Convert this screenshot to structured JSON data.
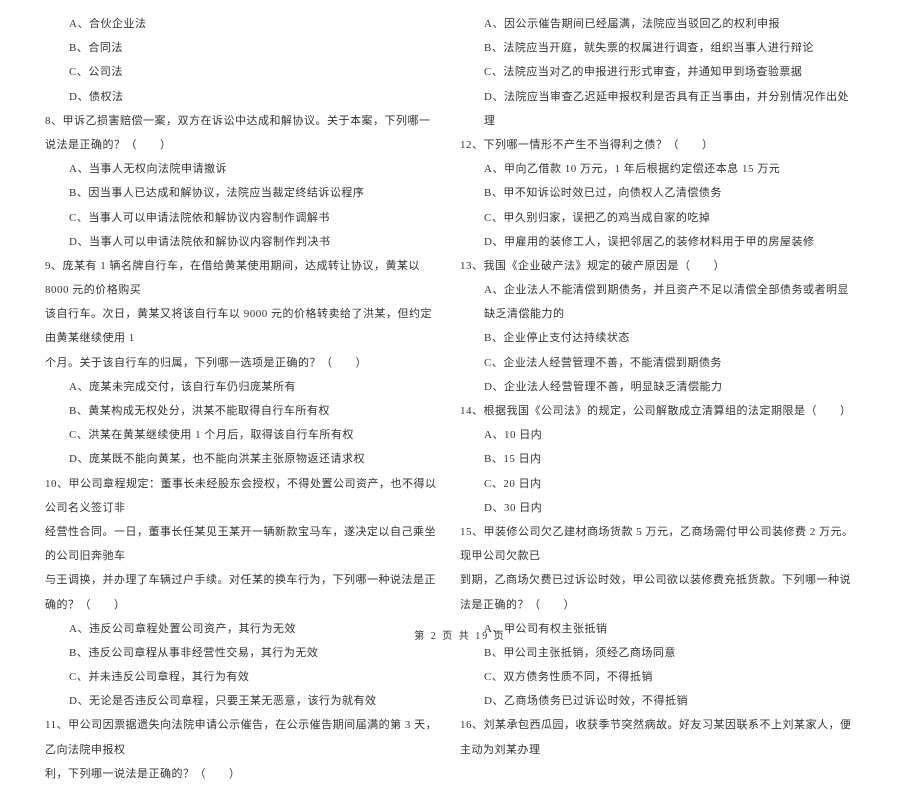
{
  "left": {
    "a1": "A、合伙企业法",
    "a2": "B、合同法",
    "a3": "C、公司法",
    "a4": "D、债权法",
    "q8": "8、甲诉乙损害赔偿一案，双方在诉讼中达成和解协议。关于本案，下列哪一说法是正确的？（　　）",
    "q8a": "A、当事人无权向法院申请撤诉",
    "q8b": "B、因当事人已达成和解协议，法院应当裁定终结诉讼程序",
    "q8c": "C、当事人可以申请法院依和解协议内容制作调解书",
    "q8d": "D、当事人可以申请法院依和解协议内容制作判决书",
    "q9": "9、庞某有 1 辆名牌自行车，在借给黄某使用期间，达成转让协议，黄某以 8000 元的价格购买",
    "q9_2": "该自行车。次日，黄某又将该自行车以 9000 元的价格转卖给了洪某，但约定由黄某继续使用 1",
    "q9_3": "个月。关于该自行车的归属，下列哪一选项是正确的？（　　）",
    "q9a": "A、庞某未完成交付，该自行车仍归庞某所有",
    "q9b": "B、黄某构成无权处分，洪某不能取得自行车所有权",
    "q9c": "C、洪某在黄某继续使用 1 个月后，取得该自行车所有权",
    "q9d": "D、庞某既不能向黄某，也不能向洪某主张原物返还请求权",
    "q10": "10、甲公司章程规定：董事长未经股东会授权，不得处置公司资产，也不得以公司名义签订非",
    "q10_2": "经营性合同。一日，董事长任某见王某开一辆新款宝马车，遂决定以自己乘坐的公司旧奔驰车",
    "q10_3": "与王调换，并办理了车辆过户手续。对任某的换车行为，下列哪一种说法是正确的？（　　）",
    "q10a": "A、违反公司章程处置公司资产，其行为无效",
    "q10b": "B、违反公司章程从事非经营性交易，其行为无效",
    "q10c": "C、并未违反公司章程，其行为有效",
    "q10d": "D、无论是否违反公司章程，只要王某无恶意，该行为就有效",
    "q11": "11、甲公司因票据遗失向法院申请公示催告，在公示催告期间届满的第 3 天，乙向法院申报权",
    "q11_2": "利，下列哪一说法是正确的？（　　）"
  },
  "right": {
    "q11a": "A、因公示催告期间已经届满，法院应当驳回乙的权利申报",
    "q11b": "B、法院应当开庭，就失票的权属进行调查，组织当事人进行辩论",
    "q11c": "C、法院应当对乙的申报进行形式审查，并通知甲到场查验票据",
    "q11d": "D、法院应当审查乙迟延申报权利是否具有正当事由，并分别情况作出处理",
    "q12": "12、下列哪一情形不产生不当得利之债？（　　）",
    "q12a": "A、甲向乙借款 10 万元，1 年后根据约定偿还本息 15 万元",
    "q12b": "B、甲不知诉讼时效已过，向债权人乙清偿债务",
    "q12c": "C、甲久别归家，误把乙的鸡当成自家的吃掉",
    "q12d": "D、甲雇用的装修工人，误把邻居乙的装修材料用于甲的房屋装修",
    "q13": "13、我国《企业破产法》规定的破产原因是（　　）",
    "q13a": "A、企业法人不能清偿到期债务，并且资产不足以清偿全部债务或者明显缺乏清偿能力的",
    "q13b": "B、企业停止支付达持续状态",
    "q13c": "C、企业法人经营管理不善，不能清偿到期债务",
    "q13d": "D、企业法人经营管理不善，明显缺乏清偿能力",
    "q14": "14、根据我国《公司法》的规定，公司解散成立清算组的法定期限是（　　）",
    "q14a": "A、10 日内",
    "q14b": "B、15 日内",
    "q14c": "C、20 日内",
    "q14d": "D、30 日内",
    "q15": "15、甲装修公司欠乙建材商场货款 5 万元，乙商场需付甲公司装修费 2 万元。现甲公司欠款已",
    "q15_2": "到期，乙商场欠费已过诉讼时效，甲公司欲以装修费充抵货款。下列哪一种说法是正确的？（　　）",
    "q15a": "A、甲公司有权主张抵销",
    "q15b": "B、甲公司主张抵销，须经乙商场同意",
    "q15c": "C、双方债务性质不同，不得抵销",
    "q15d": "D、乙商场债务已过诉讼时效，不得抵销",
    "q16": "16、刘某承包西瓜园，收获季节突然病故。好友习某因联系不上刘某家人，便主动为刘某办理"
  },
  "footer": "第 2 页 共 19 页"
}
